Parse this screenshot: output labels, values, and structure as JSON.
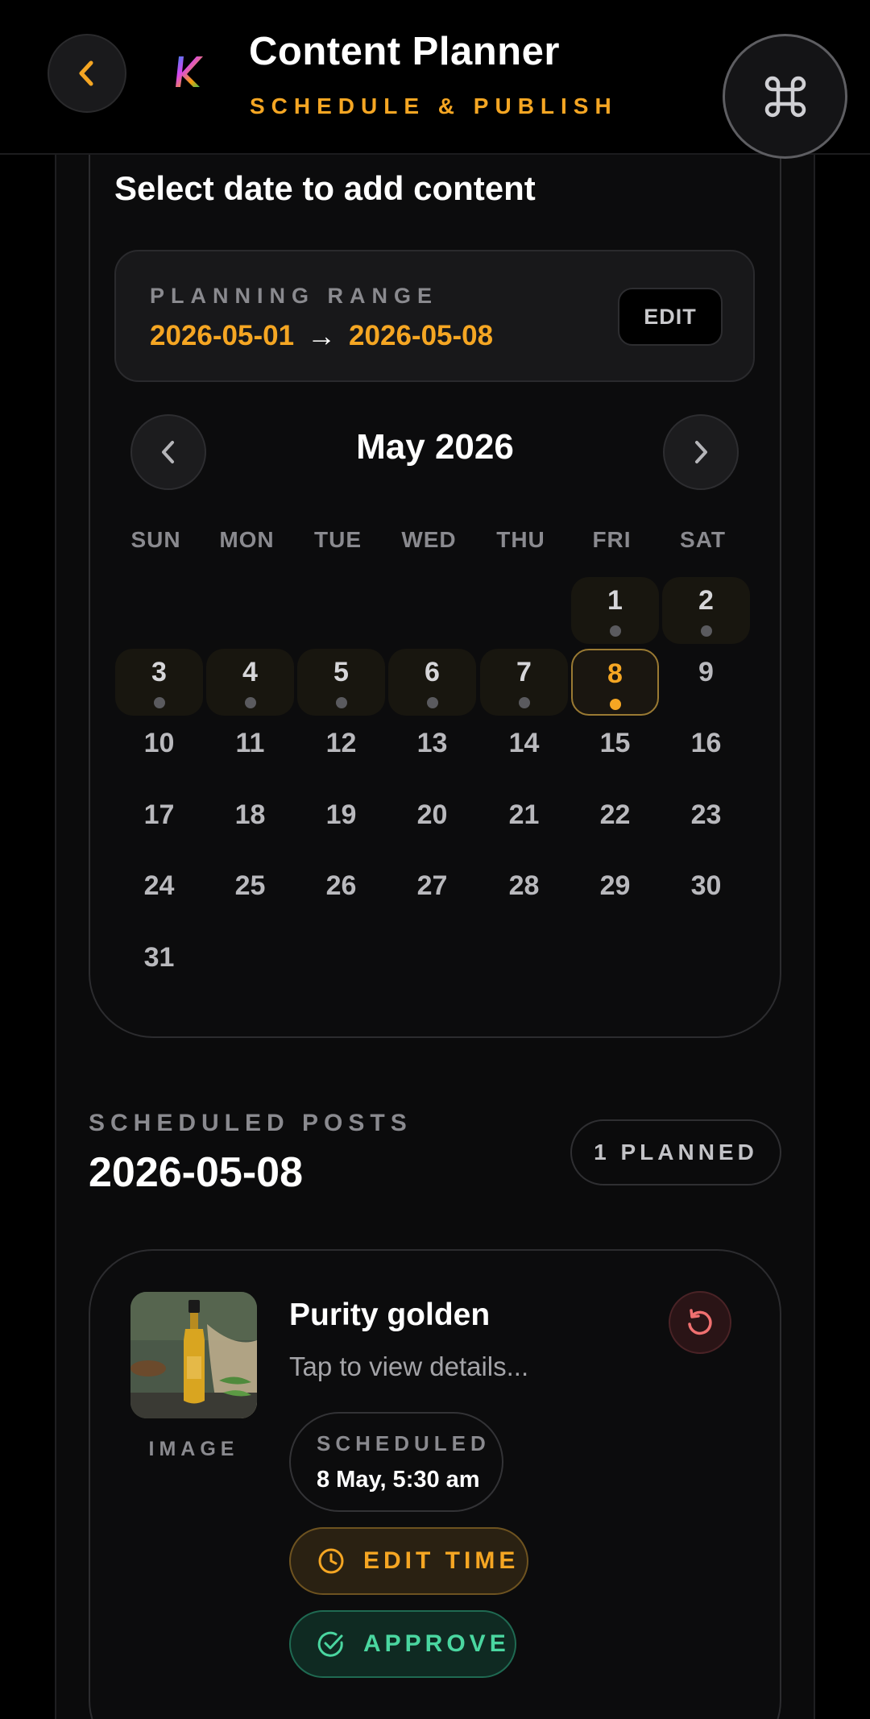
{
  "header": {
    "title": "Content Planner",
    "subtitle": "SCHEDULE & PUBLISH",
    "back_icon": "chevron-left-icon",
    "command_icon": "command-icon",
    "accent": "#f5a623"
  },
  "calendar": {
    "heading": "Select date to add content",
    "range": {
      "label": "PLANNING RANGE",
      "start": "2026-05-01",
      "arrow": "→",
      "end": "2026-05-08",
      "edit_label": "EDIT"
    },
    "month_label": "May 2026",
    "weekdays": [
      "SUN",
      "MON",
      "TUE",
      "WED",
      "THU",
      "FRI",
      "SAT"
    ],
    "days": [
      "1",
      "2",
      "3",
      "4",
      "5",
      "6",
      "7",
      "8",
      "9",
      "10",
      "11",
      "12",
      "13",
      "14",
      "15",
      "16",
      "17",
      "18",
      "19",
      "20",
      "21",
      "22",
      "23",
      "24",
      "25",
      "26",
      "27",
      "28",
      "29",
      "30",
      "31"
    ],
    "selected_day": "8",
    "range_days": [
      "1",
      "2",
      "3",
      "4",
      "5",
      "6",
      "7",
      "8"
    ]
  },
  "scheduled": {
    "label": "SCHEDULED POSTS",
    "date": "2026-05-08",
    "planned_badge": "1 PLANNED",
    "post": {
      "title": "Purity golden",
      "description": "Tap to view details...",
      "media_type": "IMAGE",
      "scheduled_label": "SCHEDULED",
      "scheduled_value": "8 May, 5:30 am",
      "edit_time_label": "EDIT TIME",
      "approve_label": "APPROVE"
    }
  }
}
